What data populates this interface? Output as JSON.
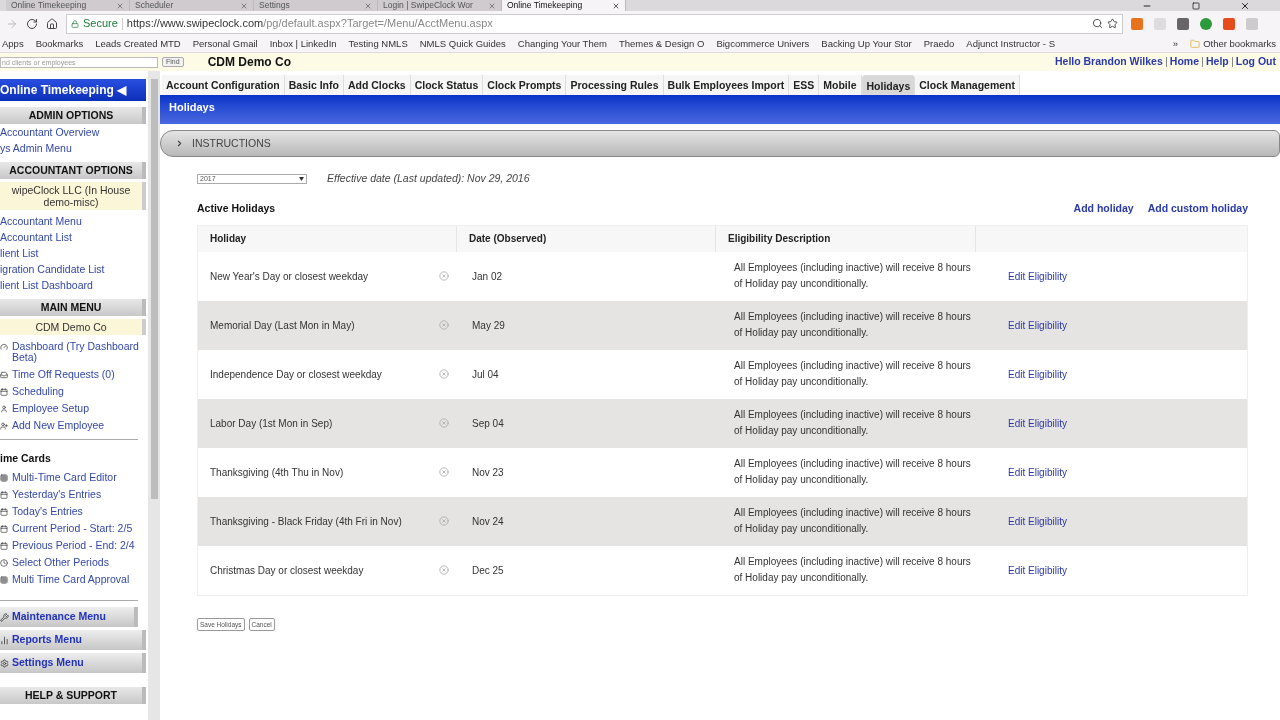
{
  "browser": {
    "tabs": [
      {
        "title": "Online Timekeeping",
        "selected": false
      },
      {
        "title": "Scheduler",
        "selected": false
      },
      {
        "title": "Settings",
        "selected": false
      },
      {
        "title": "Login | SwipeClock Wor",
        "selected": false
      },
      {
        "title": "Online Timekeeping",
        "selected": true
      }
    ],
    "address": {
      "secure_label": "Secure",
      "url_host": "https://www.swipeclock.com",
      "url_path": "/pg/default.aspx?Target=/Menu/AcctMenu.aspx"
    },
    "bookmarks": [
      "Apps",
      "Bookmarks",
      "Leads Created MTD",
      "Personal Gmail",
      "Inbox | LinkedIn",
      "Testing NMLS",
      "NMLS Quick Guides",
      "Changing Your Them",
      "Themes & Design O",
      "Bigcommerce Univers",
      "Backing Up Your Stor",
      "Praedo",
      "Adjunct Instructor - S"
    ],
    "more_bookmarks": "»",
    "other_bookmarks": "Other bookmarks"
  },
  "header": {
    "search_placeholder": "nd clients or employees",
    "find_button": "Find",
    "company": "CDM Demo Co",
    "user_links": [
      "Hello Brandon Wilkes",
      "Home",
      "Help",
      "Log Out"
    ]
  },
  "sidebar": {
    "items": [
      {
        "kind": "banner",
        "label": "Online Timekeeping ◀"
      },
      {
        "kind": "heading",
        "label": "ADMIN OPTIONS"
      },
      {
        "kind": "link",
        "label": "Accountant Overview"
      },
      {
        "kind": "link",
        "label": "ys Admin Menu"
      },
      {
        "kind": "heading",
        "label": "ACCOUNTANT OPTIONS"
      },
      {
        "kind": "client",
        "label": "wipeClock LLC (In House demo-misc)"
      },
      {
        "kind": "link",
        "label": "Accountant Menu"
      },
      {
        "kind": "link",
        "label": "Accountant List"
      },
      {
        "kind": "link",
        "label": "lient List"
      },
      {
        "kind": "link",
        "label": "igration Candidate List"
      },
      {
        "kind": "link",
        "label": "lient List Dashboard"
      },
      {
        "kind": "heading",
        "label": "MAIN MENU"
      },
      {
        "kind": "client",
        "label": "CDM Demo Co"
      },
      {
        "kind": "icon_link",
        "label": "Dashboard (Try Dashboard Beta)"
      },
      {
        "kind": "icon_link",
        "label": "Time Off Requests (0)"
      },
      {
        "kind": "icon_link",
        "label": "Scheduling"
      },
      {
        "kind": "icon_link",
        "label": "Employee Setup"
      },
      {
        "kind": "icon_link",
        "label": "Add New Employee"
      },
      {
        "kind": "section_label",
        "label": "ime Cards"
      },
      {
        "kind": "icon_link",
        "label": "Multi-Time Card Editor"
      },
      {
        "kind": "icon_link",
        "label": "Yesterday's Entries"
      },
      {
        "kind": "icon_link",
        "label": "Today's Entries"
      },
      {
        "kind": "icon_link",
        "label": "Current Period - Start: 2/5"
      },
      {
        "kind": "icon_link",
        "label": "Previous Period - End: 2/4"
      },
      {
        "kind": "icon_link",
        "label": "Select Other Periods"
      },
      {
        "kind": "icon_link",
        "label": "Multi Time Card Approval"
      },
      {
        "kind": "menu_button",
        "label": "Maintenance Menu"
      },
      {
        "kind": "menu_button",
        "label": "Reports Menu"
      },
      {
        "kind": "menu_button",
        "label": "Settings Menu"
      },
      {
        "kind": "heading",
        "label": "HELP & SUPPORT"
      }
    ]
  },
  "tabs": [
    {
      "label": "Account Configuration",
      "selected": false
    },
    {
      "label": "Basic Info",
      "selected": false
    },
    {
      "label": "Add Clocks",
      "selected": false
    },
    {
      "label": "Clock Status",
      "selected": false
    },
    {
      "label": "Clock Prompts",
      "selected": false
    },
    {
      "label": "Processing Rules",
      "selected": false
    },
    {
      "label": "Bulk Employees Import",
      "selected": false
    },
    {
      "label": "ESS",
      "selected": false
    },
    {
      "label": "Mobile",
      "selected": false
    },
    {
      "label": "Holidays",
      "selected": true
    },
    {
      "label": "Clock Management",
      "selected": false
    }
  ],
  "section_title": "Holidays",
  "instructions": {
    "label": "INSTRUCTIONS",
    "expanded": false
  },
  "year_select": {
    "value": "2017"
  },
  "effective_date": "Effective date (Last updated): Nov 29, 2016",
  "active_title": "Active Holidays",
  "actions": [
    "Add holiday",
    "Add custom holiday"
  ],
  "table": {
    "columns": [
      "Holiday",
      "Date (Observed)",
      "Eligibility Description"
    ],
    "rows": [
      {
        "holiday": "New Year's Day or closest weekday",
        "date": "Jan 02",
        "description": "All Employees (including inactive) will receive 8 hours of Holiday pay unconditionally.",
        "action": "Edit Eligibility"
      },
      {
        "holiday": "Memorial Day (Last Mon in May)",
        "date": "May 29",
        "description": "All Employees (including inactive) will receive 8 hours of Holiday pay unconditionally.",
        "action": "Edit Eligibility"
      },
      {
        "holiday": "Independence Day or closest weekday",
        "date": "Jul 04",
        "description": "All Employees (including inactive) will receive 8 hours of Holiday pay unconditionally.",
        "action": "Edit Eligibility"
      },
      {
        "holiday": "Labor Day (1st Mon in Sep)",
        "date": "Sep 04",
        "description": "All Employees (including inactive) will receive 8 hours of Holiday pay unconditionally.",
        "action": "Edit Eligibility"
      },
      {
        "holiday": "Thanksgiving (4th Thu in Nov)",
        "date": "Nov 23",
        "description": "All Employees (including inactive) will receive 8 hours of Holiday pay unconditionally.",
        "action": "Edit Eligibility"
      },
      {
        "holiday": "Thanksgiving - Black Friday (4th Fri in Nov)",
        "date": "Nov 24",
        "description": "All Employees (including inactive) will receive 8 hours of Holiday pay unconditionally.",
        "action": "Edit Eligibility"
      },
      {
        "holiday": "Christmas Day or closest weekday",
        "date": "Dec 25",
        "description": "All Employees (including inactive) will receive 8 hours of Holiday pay unconditionally.",
        "action": "Edit Eligibility"
      }
    ]
  },
  "buttons": [
    "Save Holidays",
    "Cancel"
  ]
}
